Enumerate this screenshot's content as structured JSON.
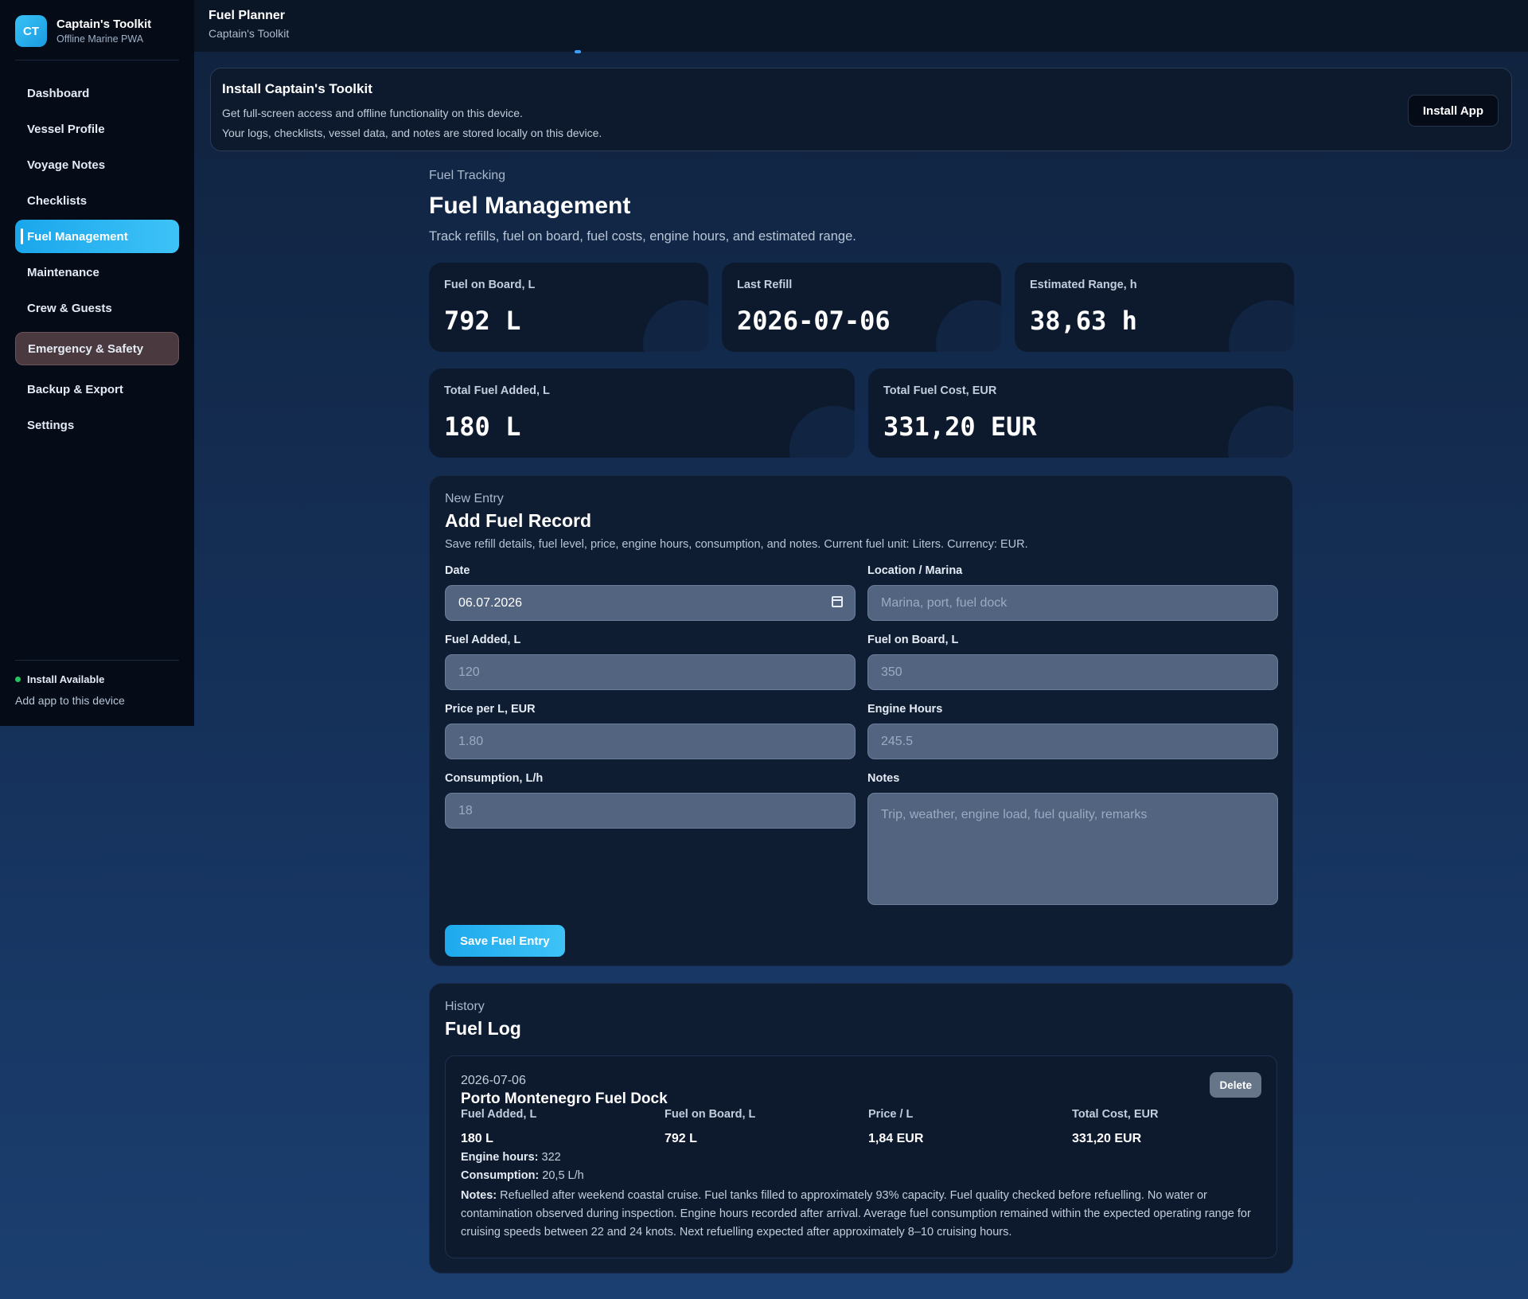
{
  "brand": {
    "logo_text": "CT",
    "title": "Captain's Toolkit",
    "subtitle": "Offline Marine PWA"
  },
  "sidebar": {
    "items": [
      {
        "label": "Dashboard"
      },
      {
        "label": "Vessel Profile"
      },
      {
        "label": "Voyage Notes"
      },
      {
        "label": "Checklists"
      },
      {
        "label": "Fuel Management",
        "active": true
      },
      {
        "label": "Maintenance"
      },
      {
        "label": "Crew & Guests"
      },
      {
        "label": "Emergency & Safety"
      },
      {
        "label": "Backup & Export"
      },
      {
        "label": "Settings"
      }
    ],
    "install_status": "Install Available",
    "install_sub": "Add app to this device"
  },
  "topbar": {
    "title": "Fuel Planner",
    "subtitle": "Captain's Toolkit"
  },
  "banner": {
    "title": "Install Captain's Toolkit",
    "line1": "Get full-screen access and offline functionality on this device.",
    "line2": "Your logs, checklists, vessel data, and notes are stored locally on this device.",
    "button": "Install App"
  },
  "page": {
    "eyebrow": "Fuel Tracking",
    "title": "Fuel Management",
    "description": "Track refills, fuel on board, fuel costs, engine hours, and estimated range."
  },
  "stats": [
    {
      "label": "Fuel on Board, L",
      "value": "792 L"
    },
    {
      "label": "Last Refill",
      "value": "2026-07-06"
    },
    {
      "label": "Estimated Range, h",
      "value": "38,63 h"
    },
    {
      "label": "Total Fuel Added, L",
      "value": "180 L"
    },
    {
      "label": "Total Fuel Cost, EUR",
      "value": "331,20 EUR"
    }
  ],
  "form": {
    "eyebrow": "New Entry",
    "title": "Add Fuel Record",
    "description": "Save refill details, fuel level, price, engine hours, consumption, and notes. Current fuel unit: Liters. Currency: EUR.",
    "date": {
      "label": "Date",
      "value": "06.07.2026"
    },
    "location": {
      "label": "Location / Marina",
      "placeholder": "Marina, port, fuel dock"
    },
    "fuel_added": {
      "label": "Fuel Added, L",
      "placeholder": "120"
    },
    "fuel_on_board": {
      "label": "Fuel on Board, L",
      "placeholder": "350"
    },
    "price": {
      "label": "Price per L, EUR",
      "placeholder": "1.80"
    },
    "engine_hours": {
      "label": "Engine Hours",
      "placeholder": "245.5"
    },
    "consumption": {
      "label": "Consumption, L/h",
      "placeholder": "18"
    },
    "notes": {
      "label": "Notes",
      "placeholder": "Trip, weather, engine load, fuel quality, remarks"
    },
    "save_button": "Save Fuel Entry"
  },
  "history": {
    "eyebrow": "History",
    "title": "Fuel Log",
    "entries": [
      {
        "date": "2026-07-06",
        "location": "Porto Montenegro Fuel Dock",
        "delete_label": "Delete",
        "fuel_added_label": "Fuel Added, L",
        "fuel_added": "180 L",
        "fuel_on_board_label": "Fuel on Board, L",
        "fuel_on_board": "792 L",
        "price_label": "Price / L",
        "price": "1,84 EUR",
        "total_label": "Total Cost, EUR",
        "total": "331,20 EUR",
        "engine_hours_label": "Engine hours:",
        "engine_hours": "322",
        "consumption_label": "Consumption:",
        "consumption": "20,5 L/h",
        "notes_label": "Notes:",
        "notes": "Refuelled after weekend coastal cruise. Fuel tanks filled to approximately 93% capacity. Fuel quality checked before refuelling. No water or contamination observed during inspection. Engine hours recorded after arrival. Average fuel consumption remained within the expected operating range for cruising speeds between 22 and 24 knots. Next refuelling expected after approximately 8–10 cruising hours."
      }
    ]
  },
  "colors": {
    "accent": "#2bb4f2",
    "status_dot": "#22c55e",
    "sidebar_bg": "#050c18"
  }
}
